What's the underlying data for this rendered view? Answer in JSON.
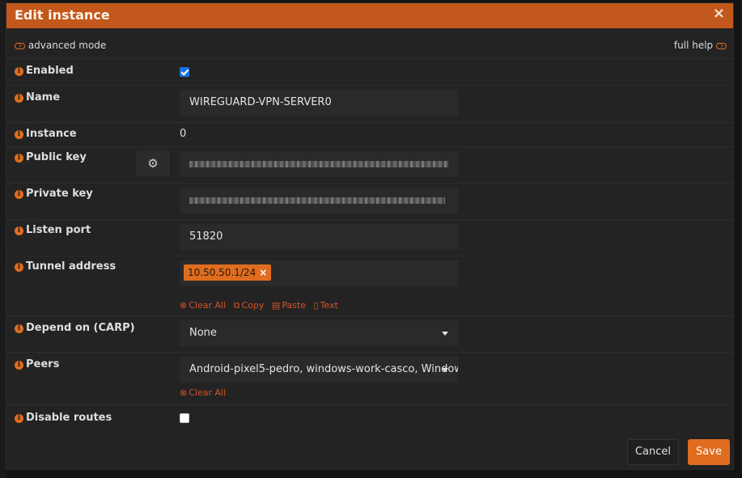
{
  "dialog": {
    "title": "Edit instance",
    "close_glyph": "×"
  },
  "toggles": {
    "advanced_mode": "advanced mode",
    "full_help": "full help"
  },
  "fields": {
    "enabled": {
      "label": "Enabled",
      "checked": true
    },
    "name": {
      "label": "Name",
      "value": "WIREGUARD-VPN-SERVER0"
    },
    "instance": {
      "label": "Instance",
      "value": "0"
    },
    "public_key": {
      "label": "Public key",
      "generate_icon": "gear-icon"
    },
    "private_key": {
      "label": "Private key"
    },
    "listen_port": {
      "label": "Listen port",
      "value": "51820"
    },
    "tunnel_address": {
      "label": "Tunnel address",
      "tags": [
        "10.50.50.1/24"
      ],
      "tag_remove": "×"
    },
    "depend_on": {
      "label": "Depend on (CARP)",
      "value": "None"
    },
    "peers": {
      "label": "Peers",
      "value": "Android-pixel5-pedro, windows-work-casco, Window"
    },
    "disable_routes": {
      "label": "Disable routes",
      "checked": false
    }
  },
  "tokenizer_actions": {
    "clear_all": "Clear All",
    "copy": "Copy",
    "paste": "Paste",
    "text": "Text"
  },
  "info_glyph": "i",
  "footer": {
    "cancel": "Cancel",
    "save": "Save"
  },
  "colors": {
    "accent": "#e06d1f",
    "header": "#c2581c",
    "dialog_bg": "#232323",
    "input_bg": "#2a2a2a",
    "link_red": "#d6532a"
  }
}
